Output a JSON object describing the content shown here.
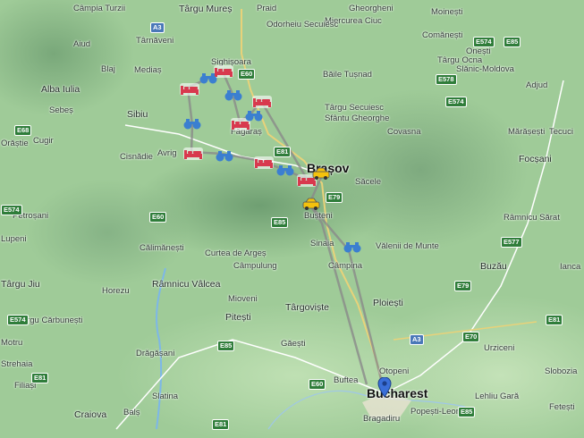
{
  "map": {
    "places": [
      {
        "name": "Câmpia Turzii",
        "cls": "lbl"
      },
      {
        "name": "Târgu Mureș",
        "cls": "lbl city"
      },
      {
        "name": "Praid",
        "cls": "lbl"
      },
      {
        "name": "Gheorgheni",
        "cls": "lbl"
      },
      {
        "name": "Miercurea Ciuc",
        "cls": "lbl"
      },
      {
        "name": "Moinești",
        "cls": "lbl"
      },
      {
        "name": "Aiud",
        "cls": "lbl"
      },
      {
        "name": "Târnăveni",
        "cls": "lbl"
      },
      {
        "name": "Odorheiu Secuiesc",
        "cls": "lbl"
      },
      {
        "name": "Comănești",
        "cls": "lbl"
      },
      {
        "name": "Blaj",
        "cls": "lbl"
      },
      {
        "name": "Mediaș",
        "cls": "lbl"
      },
      {
        "name": "Sighișoara",
        "cls": "lbl"
      },
      {
        "name": "Târgu Ocna",
        "cls": "lbl"
      },
      {
        "name": "Onești",
        "cls": "lbl"
      },
      {
        "name": "Slănic-Moldova",
        "cls": "lbl"
      },
      {
        "name": "Alba Iulia",
        "cls": "lbl city"
      },
      {
        "name": "Băile Tușnad",
        "cls": "lbl"
      },
      {
        "name": "Adjud",
        "cls": "lbl"
      },
      {
        "name": "Sebeș",
        "cls": "lbl"
      },
      {
        "name": "Târgu Secuiesc",
        "cls": "lbl"
      },
      {
        "name": "Sfântu Gheorghe",
        "cls": "lbl"
      },
      {
        "name": "Sibiu",
        "cls": "lbl city"
      },
      {
        "name": "Făgăraș",
        "cls": "lbl"
      },
      {
        "name": "Covasna",
        "cls": "lbl"
      },
      {
        "name": "Mărășești",
        "cls": "lbl"
      },
      {
        "name": "Tecuci",
        "cls": "lbl"
      },
      {
        "name": "Orăștie",
        "cls": "lbl"
      },
      {
        "name": "Cugir",
        "cls": "lbl"
      },
      {
        "name": "Cisnădie",
        "cls": "lbl"
      },
      {
        "name": "Avrig",
        "cls": "lbl"
      },
      {
        "name": "Brașov",
        "cls": "lbl big"
      },
      {
        "name": "Focșani",
        "cls": "lbl city"
      },
      {
        "name": "Săcele",
        "cls": "lbl"
      },
      {
        "name": "Petroșani",
        "cls": "lbl"
      },
      {
        "name": "Bușteni",
        "cls": "lbl"
      },
      {
        "name": "Râmnicu Sărat",
        "cls": "lbl"
      },
      {
        "name": "Lupeni",
        "cls": "lbl"
      },
      {
        "name": "Călimănești",
        "cls": "lbl"
      },
      {
        "name": "Curtea de Argeș",
        "cls": "lbl"
      },
      {
        "name": "Câmpulung",
        "cls": "lbl"
      },
      {
        "name": "Sinaia",
        "cls": "lbl"
      },
      {
        "name": "Vălenii de Munte",
        "cls": "lbl"
      },
      {
        "name": "Buzău",
        "cls": "lbl city"
      },
      {
        "name": "Târgu Jiu",
        "cls": "lbl city"
      },
      {
        "name": "Horezu",
        "cls": "lbl"
      },
      {
        "name": "Râmnicu Vâlcea",
        "cls": "lbl city"
      },
      {
        "name": "Câmpina",
        "cls": "lbl"
      },
      {
        "name": "Ianca",
        "cls": "lbl"
      },
      {
        "name": "Târgu Cărbunești",
        "cls": "lbl"
      },
      {
        "name": "Mioveni",
        "cls": "lbl"
      },
      {
        "name": "Ploiești",
        "cls": "lbl city"
      },
      {
        "name": "Motru",
        "cls": "lbl"
      },
      {
        "name": "Pitești",
        "cls": "lbl city"
      },
      {
        "name": "Târgoviște",
        "cls": "lbl city"
      },
      {
        "name": "Strehaia",
        "cls": "lbl"
      },
      {
        "name": "Găești",
        "cls": "lbl"
      },
      {
        "name": "Urziceni",
        "cls": "lbl"
      },
      {
        "name": "Drăgășani",
        "cls": "lbl"
      },
      {
        "name": "Otopeni",
        "cls": "lbl"
      },
      {
        "name": "Slobozia",
        "cls": "lbl"
      },
      {
        "name": "Filiași",
        "cls": "lbl"
      },
      {
        "name": "Buftea",
        "cls": "lbl"
      },
      {
        "name": "Slatina",
        "cls": "lbl"
      },
      {
        "name": "Bucharest",
        "cls": "lbl big"
      },
      {
        "name": "Lehliu Gară",
        "cls": "lbl"
      },
      {
        "name": "Fetești",
        "cls": "lbl"
      },
      {
        "name": "Craiova",
        "cls": "lbl city"
      },
      {
        "name": "Balș",
        "cls": "lbl"
      },
      {
        "name": "Popești-Leordeni",
        "cls": "lbl"
      },
      {
        "name": "Bragadiru",
        "cls": "lbl"
      }
    ],
    "roads": [
      "A3",
      "E60",
      "E574",
      "E85",
      "E578",
      "E68",
      "E574",
      "E81",
      "E79",
      "E60",
      "E574",
      "E85",
      "E577",
      "E79",
      "E574",
      "E85",
      "E81",
      "E70",
      "E81",
      "E60",
      "A3",
      "E85",
      "E81"
    ],
    "route_color": "#8a8a8a",
    "marker_colors": {
      "lodging": "#d8394e",
      "tour": "#3b7fd0",
      "car": "#f4c20d",
      "pin": "#3a6fd8"
    },
    "markers": [
      {
        "type": "lodging"
      },
      {
        "type": "lodging"
      },
      {
        "type": "lodging"
      },
      {
        "type": "lodging"
      },
      {
        "type": "lodging"
      },
      {
        "type": "lodging"
      },
      {
        "type": "lodging"
      },
      {
        "type": "tour"
      },
      {
        "type": "tour"
      },
      {
        "type": "tour"
      },
      {
        "type": "tour"
      },
      {
        "type": "tour"
      },
      {
        "type": "tour"
      },
      {
        "type": "tour"
      },
      {
        "type": "car"
      },
      {
        "type": "car"
      },
      {
        "type": "pin"
      }
    ]
  }
}
